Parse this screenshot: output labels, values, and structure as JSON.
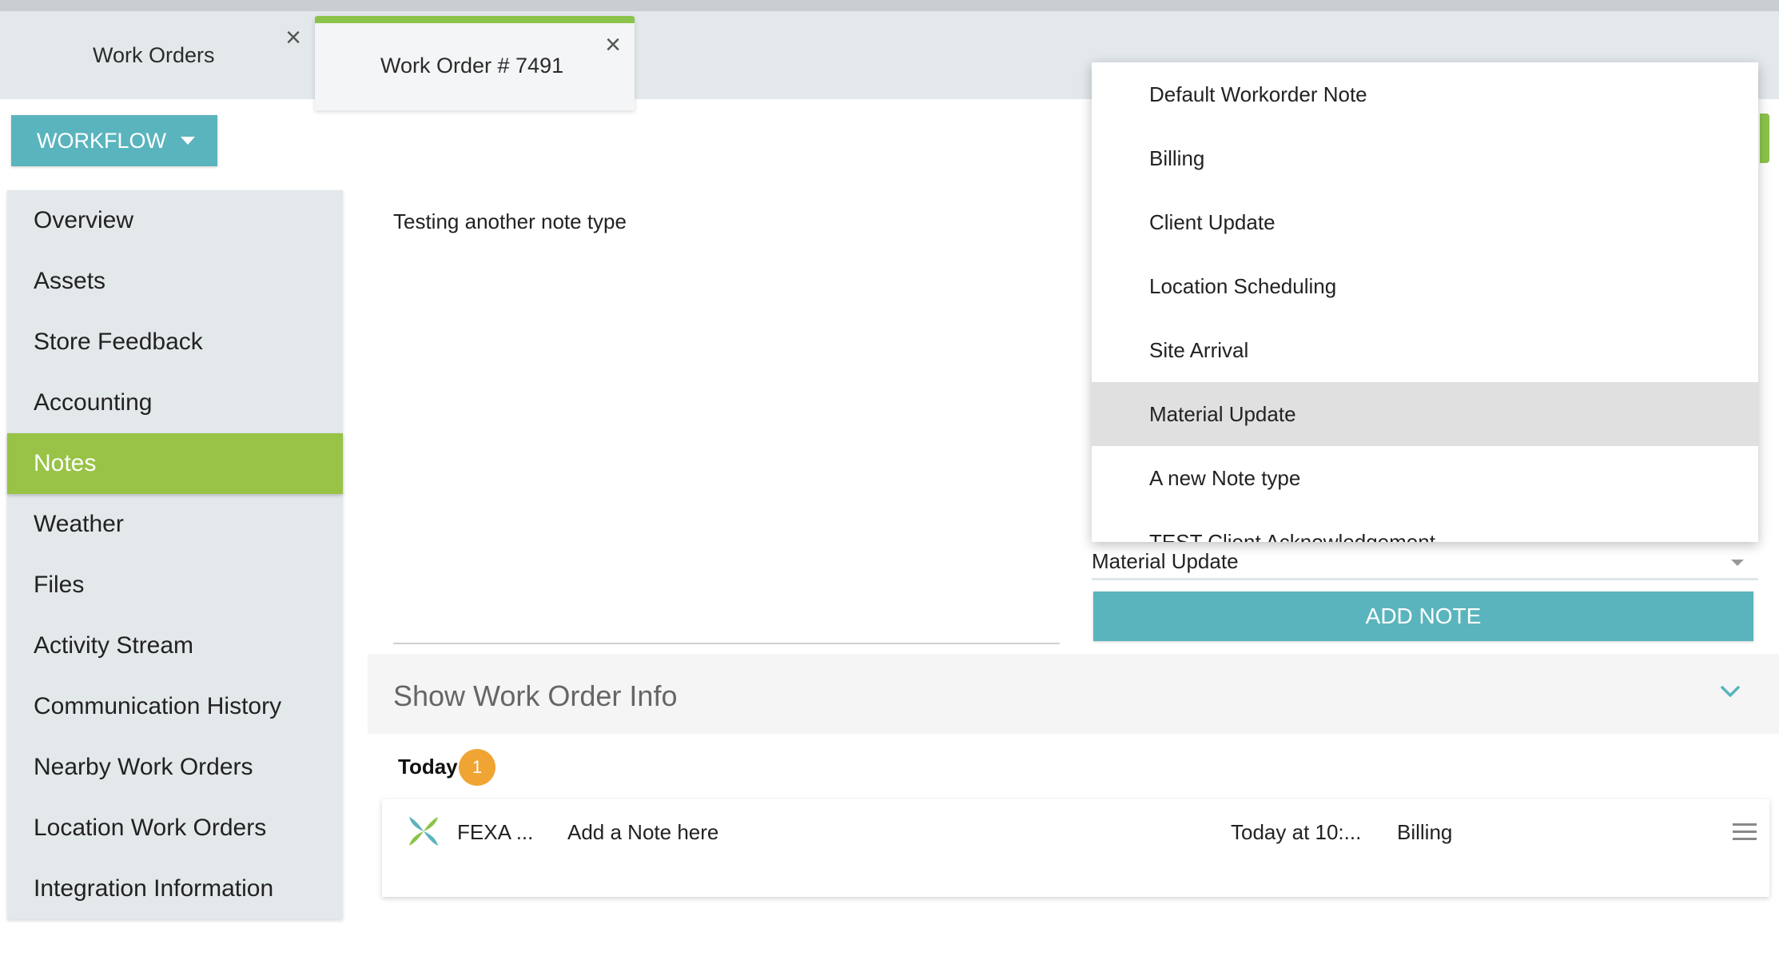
{
  "tabs": [
    {
      "label": "Work Orders",
      "close_icon": "close-icon"
    },
    {
      "label": "Work Order # 7491",
      "close_icon": "close-icon",
      "active_color": "#8bc34a"
    }
  ],
  "workflow": {
    "label": "WORKFLOW",
    "color": "#5ab4bd"
  },
  "sidebar": {
    "items": [
      {
        "label": "Overview"
      },
      {
        "label": "Assets"
      },
      {
        "label": "Store Feedback"
      },
      {
        "label": "Accounting"
      },
      {
        "label": "Notes"
      },
      {
        "label": "Weather"
      },
      {
        "label": "Files"
      },
      {
        "label": "Activity Stream"
      },
      {
        "label": "Communication History"
      },
      {
        "label": "Nearby Work Orders"
      },
      {
        "label": "Location Work Orders"
      },
      {
        "label": "Integration Information"
      }
    ],
    "active": "Notes",
    "active_color": "#98c346"
  },
  "note_editor": {
    "text": "Testing another note type"
  },
  "note_type_dropdown": {
    "options": [
      "Default Workorder Note",
      "Billing",
      "Client Update",
      "Location Scheduling",
      "Site Arrival",
      "Material Update",
      "A new Note type",
      "TEST Client Acknowledgement"
    ],
    "highlighted": "Material Update"
  },
  "note_type_select": {
    "value": "Material Update"
  },
  "add_note": {
    "label": "ADD NOTE",
    "color": "#5ab4bd"
  },
  "work_order_info": {
    "label": "Show Work Order Info",
    "chevron_color": "#5ab4bd"
  },
  "notes_list": {
    "group_label": "Today",
    "count": "1",
    "badge_color": "#f0a433",
    "rows": [
      {
        "author": "FEXA ...",
        "body": "Add a Note here",
        "time": "Today at 10:...",
        "type": "Billing"
      }
    ]
  }
}
